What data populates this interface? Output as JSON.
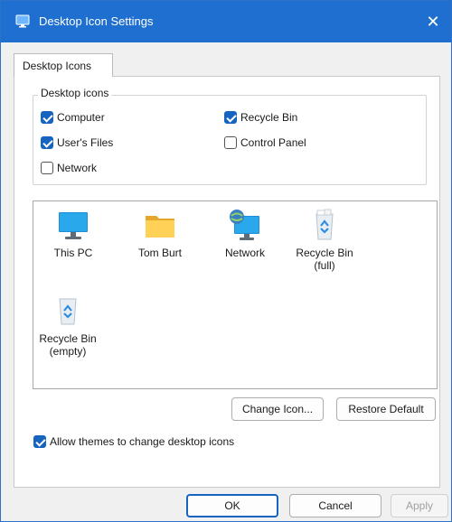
{
  "window": {
    "title": "Desktop Icon Settings",
    "close_glyph": "✕"
  },
  "tab": {
    "label": "Desktop Icons"
  },
  "group": {
    "label": "Desktop icons",
    "items": [
      {
        "label": "Computer",
        "checked": true
      },
      {
        "label": "Recycle Bin",
        "checked": true
      },
      {
        "label": "User's Files",
        "checked": true
      },
      {
        "label": "Control Panel",
        "checked": false
      },
      {
        "label": "Network",
        "checked": false
      }
    ]
  },
  "icons": [
    {
      "label": "This PC",
      "icon": "monitor-icon"
    },
    {
      "label": "Tom Burt",
      "icon": "folder-icon"
    },
    {
      "label": "Network",
      "icon": "network-icon"
    },
    {
      "label": "Recycle Bin\n(full)",
      "icon": "recycle-bin-full-icon"
    },
    {
      "label": "Recycle Bin\n(empty)",
      "icon": "recycle-bin-empty-icon"
    }
  ],
  "buttons": {
    "change_icon": "Change Icon...",
    "restore_default": "Restore Default",
    "ok": "OK",
    "cancel": "Cancel",
    "apply": "Apply"
  },
  "allow_themes": {
    "label": "Allow themes to change desktop icons",
    "checked": true
  },
  "colors": {
    "titlebar": "#1f6fd1",
    "accent": "#1565c0"
  }
}
